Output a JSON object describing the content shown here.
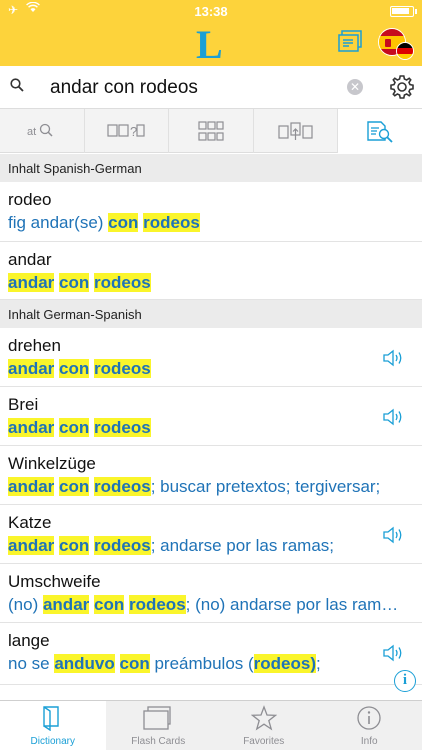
{
  "status": {
    "time": "13:38",
    "battery_level": 0.9
  },
  "header": {
    "logo": "L"
  },
  "search": {
    "query": "andar con rodeos"
  },
  "sections": [
    {
      "title": "Inhalt Spanish-German",
      "entries": [
        {
          "headword": "rodeo",
          "translation": [
            [
              "fig andar(se) ",
              false
            ],
            [
              "con",
              true
            ],
            [
              " ",
              false
            ],
            [
              "rodeos",
              true
            ]
          ],
          "audio": false
        },
        {
          "headword": "andar",
          "translation": [
            [
              "andar",
              true
            ],
            [
              " ",
              false
            ],
            [
              "con",
              true
            ],
            [
              " ",
              false
            ],
            [
              "rodeos",
              true
            ]
          ],
          "audio": false
        }
      ]
    },
    {
      "title": "Inhalt German-Spanish",
      "entries": [
        {
          "headword": "drehen",
          "translation": [
            [
              "andar",
              true
            ],
            [
              " ",
              false
            ],
            [
              "con",
              true
            ],
            [
              " ",
              false
            ],
            [
              "rodeos",
              true
            ]
          ],
          "audio": true
        },
        {
          "headword": "Brei",
          "translation": [
            [
              "andar",
              true
            ],
            [
              " ",
              false
            ],
            [
              "con",
              true
            ],
            [
              " ",
              false
            ],
            [
              "rodeos",
              true
            ]
          ],
          "audio": true
        },
        {
          "headword": "Winkelzüge",
          "translation": [
            [
              "andar",
              true
            ],
            [
              " ",
              false
            ],
            [
              "con",
              true
            ],
            [
              " ",
              false
            ],
            [
              "rodeos",
              true
            ],
            [
              "; buscar pretextos; tergiversar;",
              false
            ]
          ],
          "audio": false
        },
        {
          "headword": "Katze",
          "translation": [
            [
              "andar",
              true
            ],
            [
              " ",
              false
            ],
            [
              "con",
              true
            ],
            [
              " ",
              false
            ],
            [
              "rodeos",
              true
            ],
            [
              "; andarse por las ramas;",
              false
            ]
          ],
          "audio": true
        },
        {
          "headword": "Umschweife",
          "translation": [
            [
              "(no) ",
              false
            ],
            [
              "andar",
              true
            ],
            [
              " ",
              false
            ],
            [
              "con",
              true
            ],
            [
              " ",
              false
            ],
            [
              "rodeos",
              true
            ],
            [
              "; (no) andarse por las ram…",
              false
            ]
          ],
          "audio": false
        },
        {
          "headword": "lange",
          "translation": [
            [
              "no se ",
              false
            ],
            [
              "anduvo",
              true
            ],
            [
              " ",
              false
            ],
            [
              "con",
              true
            ],
            [
              " preámbulos (",
              false
            ],
            [
              "rodeos)",
              true
            ],
            [
              ";",
              false
            ]
          ],
          "audio": true
        }
      ]
    }
  ],
  "tabbar": [
    {
      "label": "Dictionary",
      "icon": "book-icon",
      "active": true
    },
    {
      "label": "Flash Cards",
      "icon": "flash-cards-icon",
      "active": false
    },
    {
      "label": "Favorites",
      "icon": "star-icon",
      "active": false
    },
    {
      "label": "Info",
      "icon": "info-icon",
      "active": false
    }
  ],
  "colors": {
    "header": "#fdd33b",
    "accent": "#1a9fd6",
    "highlight": "#faf52b",
    "translation": "#1f73b7"
  }
}
